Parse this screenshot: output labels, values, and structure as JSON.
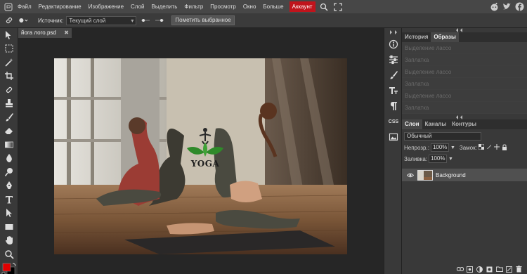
{
  "menu": {
    "items": [
      "Файл",
      "Редактирование",
      "Изображение",
      "Слой",
      "Выделить",
      "Фильтр",
      "Просмотр",
      "Окно",
      "Больше"
    ],
    "account_label": "Аккаунт",
    "accent_color": "#c0141c"
  },
  "options": {
    "source_label": "Источник:",
    "source_value": "Текущий слой",
    "apply_button": "Пометить выбранное"
  },
  "document": {
    "tab_title": "йога лого.psd",
    "close_glyph": "✖"
  },
  "watermark": {
    "text": "YOGA"
  },
  "panels": {
    "top_tabs": [
      "История",
      "Образы"
    ],
    "history": [
      "Выделение лассо",
      "Заплатка",
      "Выделение лассо",
      "Заплатка",
      "Выделение лассо",
      "Заплатка"
    ],
    "layer_tabs": [
      "Слои",
      "Каналы",
      "Контуры"
    ],
    "blend_mode": "Обычный",
    "opacity_label": "Непрозр.:",
    "opacity_value": "100%",
    "lock_label": "Замок:",
    "fill_label": "Заливка:",
    "fill_value": "100%",
    "layer_name": "Background"
  },
  "narrow_panel": {
    "css_label": "CSS"
  }
}
